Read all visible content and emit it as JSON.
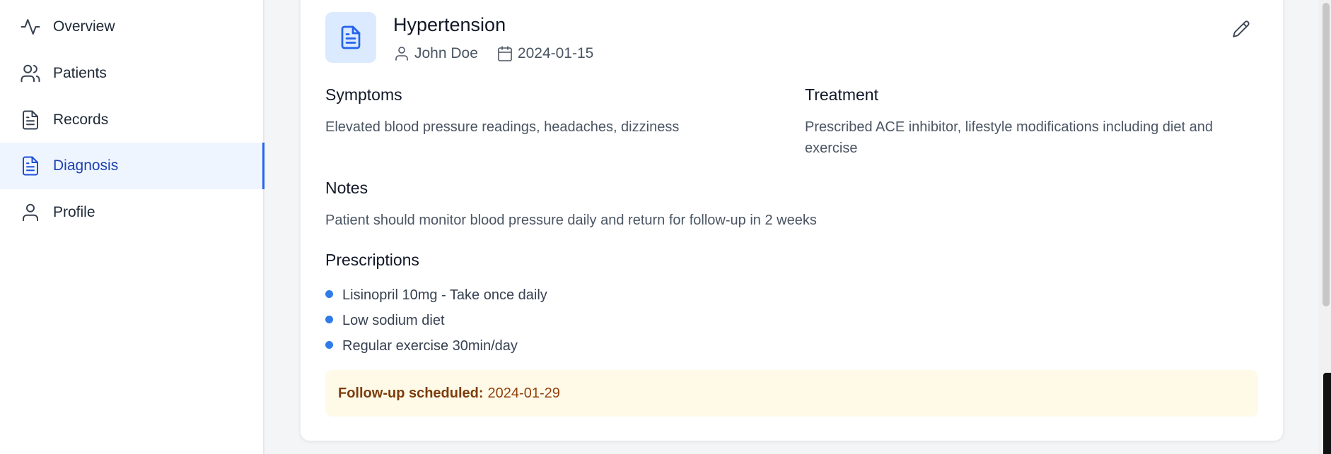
{
  "sidebar": {
    "items": [
      {
        "label": "Overview",
        "icon": "activity-icon"
      },
      {
        "label": "Patients",
        "icon": "users-icon"
      },
      {
        "label": "Records",
        "icon": "file-text-icon"
      },
      {
        "label": "Diagnosis",
        "icon": "file-text-icon",
        "active": true
      },
      {
        "label": "Profile",
        "icon": "user-icon"
      }
    ]
  },
  "diagnosis": {
    "title": "Hypertension",
    "patient": "John Doe",
    "date": "2024-01-15",
    "symptoms_heading": "Symptoms",
    "symptoms": "Elevated blood pressure readings, headaches, dizziness",
    "treatment_heading": "Treatment",
    "treatment_line1": "Prescribed ACE inhibitor, lifestyle modifications including diet and",
    "treatment_line2": "exercise",
    "notes_heading": "Notes",
    "notes": "Patient should monitor blood pressure daily and return for follow-up in 2 weeks",
    "prescriptions_heading": "Prescriptions",
    "prescriptions": [
      "Lisinopril 10mg - Take once daily",
      "Low sodium diet",
      "Regular exercise 30min/day"
    ],
    "followup_label": "Follow-up scheduled:",
    "followup_date": "2024-01-29"
  },
  "colors": {
    "accent": "#2563eb",
    "active_bg": "#eef5ff",
    "followup_bg": "#fefae7",
    "followup_text": "#92400e"
  }
}
